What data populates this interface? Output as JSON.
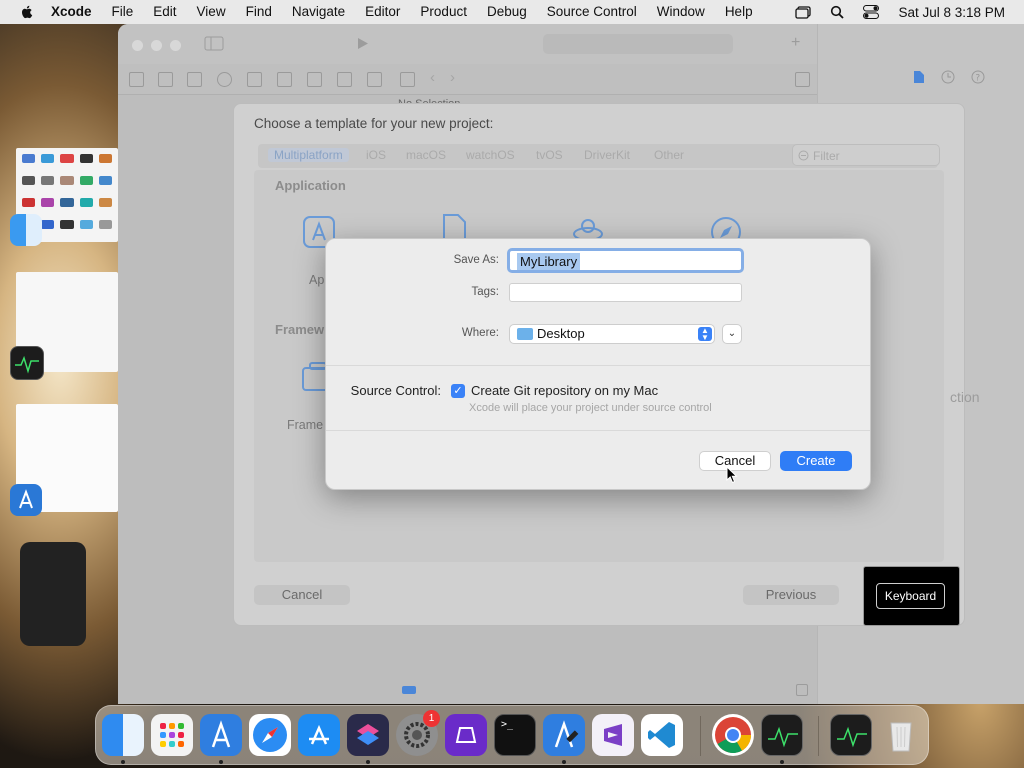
{
  "menubar": {
    "app_name": "Xcode",
    "items": [
      "File",
      "Edit",
      "View",
      "Find",
      "Navigate",
      "Editor",
      "Product",
      "Debug",
      "Source Control",
      "Window",
      "Help"
    ],
    "clock": "Sat Jul 8  3:18 PM"
  },
  "xcode": {
    "no_selection": "No Selection"
  },
  "template_sheet": {
    "title": "Choose a template for your new project:",
    "tabs": [
      "Multiplatform",
      "iOS",
      "macOS",
      "watchOS",
      "tvOS",
      "DriverKit",
      "Other"
    ],
    "filter_placeholder": "Filter",
    "section_application": "Application",
    "section_framework": "Framew",
    "app_label": "Ap",
    "framework_label": "Frame",
    "side_text": "ction",
    "cancel_label": "Cancel",
    "previous_label": "Previous"
  },
  "save_dialog": {
    "save_as_label": "Save As:",
    "save_as_value": "MyLibrary",
    "tags_label": "Tags:",
    "tags_value": "",
    "where_label": "Where:",
    "where_value": "Desktop",
    "source_control_label": "Source Control:",
    "git_checkbox_label": "Create Git repository on my Mac",
    "git_checked": true,
    "git_hint": "Xcode will place your project under source control",
    "cancel_label": "Cancel",
    "create_label": "Create"
  },
  "keyboard_overlay": {
    "label": "Keyboard"
  },
  "dock": {
    "apps": [
      "finder",
      "launchpad",
      "xcode",
      "safari",
      "app-store",
      "shortcuts",
      "system-settings",
      "simulator",
      "terminal",
      "xcode-instruments",
      "visual-studio",
      "vscode",
      "chrome",
      "activity-monitor",
      "activity-monitor-recent",
      "trash"
    ],
    "settings_badge": "1"
  },
  "colors": {
    "accent": "#2f7df6",
    "menubar_bg": "#e9e9e9",
    "dialog_bg": "#ececec"
  }
}
